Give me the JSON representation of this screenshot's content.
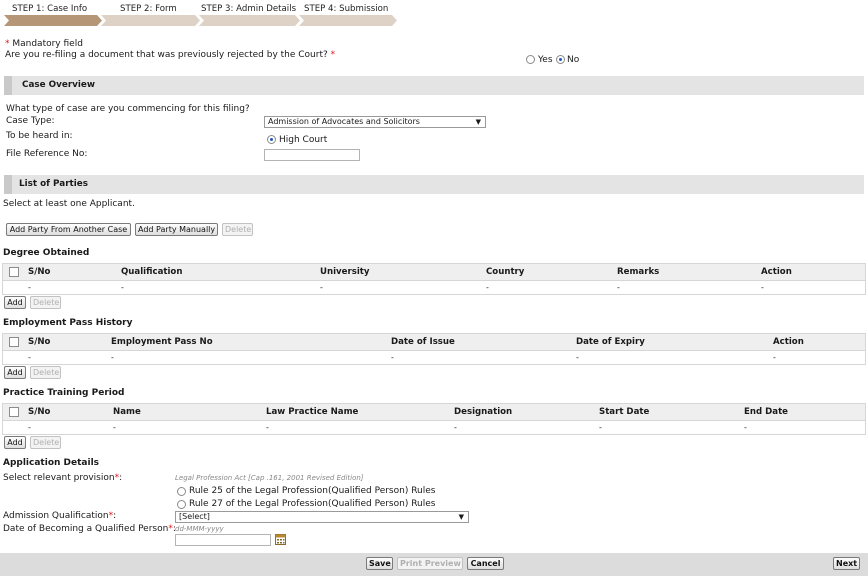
{
  "steps": [
    {
      "label": "STEP 1: Case Info",
      "active": true
    },
    {
      "label": "STEP 2: Form",
      "active": false
    },
    {
      "label": "STEP 3: Admin Details",
      "active": false
    },
    {
      "label": "STEP 4: Submission",
      "active": false
    }
  ],
  "colors": {
    "step_active": "#b59778",
    "step_inactive": "#ddd2c5",
    "required": "#e0151b"
  },
  "mandatory": {
    "star": "*",
    "text": " Mandatory field"
  },
  "refiling": {
    "question": "Are you re-filing a document that was previously rejected by the Court?",
    "star": " *",
    "yes_label": "Yes",
    "no_label": "No",
    "selected": "No"
  },
  "case_overview": {
    "title": "Case Overview",
    "question": "What type of case are you commencing for this filing?",
    "case_type_label": "Case Type:",
    "case_type_value": "Admission of Advocates and Solicitors",
    "heard_in_label": "To be heard in:",
    "heard_in_value": "High Court",
    "file_ref_label": "File Reference No:",
    "file_ref_value": ""
  },
  "parties": {
    "title": "List of Parties",
    "hint": "Select at least one Applicant.",
    "add_from_case": "Add Party From Another Case",
    "add_manually": "Add Party Manually",
    "delete": "Delete"
  },
  "degree": {
    "title": "Degree Obtained",
    "columns": [
      "S/No",
      "Qualification",
      "University",
      "Country",
      "Remarks",
      "Action"
    ],
    "row": [
      "-",
      "-",
      "-",
      "-",
      "-",
      "-"
    ],
    "add": "Add",
    "delete": "Delete"
  },
  "employment": {
    "title": "Employment Pass History",
    "columns": [
      "S/No",
      "Employment Pass No",
      "Date of Issue",
      "Date of Expiry",
      "Action"
    ],
    "row": [
      "-",
      "-",
      "-",
      "-",
      "-"
    ],
    "add": "Add",
    "delete": "Delete"
  },
  "training": {
    "title": "Practice Training Period",
    "columns": [
      "S/No",
      "Name",
      "Law Practice Name",
      "Designation",
      "Start Date",
      "End Date"
    ],
    "row": [
      "-",
      "-",
      "-",
      "-",
      "-",
      "-"
    ],
    "add": "Add",
    "delete": "Delete"
  },
  "application": {
    "title": "Application Details",
    "provision_label": "Select relevant provision",
    "star": "*",
    "colon": ":",
    "act_note": "Legal Profession Act [Cap .161, 2001 Revised Edition]",
    "rule25": "Rule 25 of the Legal Profession(Qualified Person) Rules",
    "rule27": "Rule 27 of the Legal Profession(Qualified Person) Rules",
    "admission_label": "Admission Qualification",
    "admission_value": "[Select]",
    "date_label": "Date of Becoming a Qualified Person",
    "date_placeholder": "dd-MMM-yyyy"
  },
  "footer": {
    "save": "Save",
    "print_preview": "Print Preview",
    "cancel": "Cancel",
    "next": "Next"
  }
}
